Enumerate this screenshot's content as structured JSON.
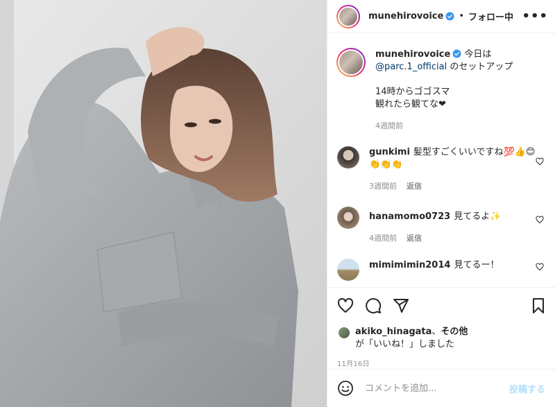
{
  "header": {
    "username": "munehirovoice",
    "separator": "•",
    "follow_status": "フォロー中",
    "more": "•••"
  },
  "caption": {
    "username": "munehirovoice",
    "line1": "今日は",
    "mention": "@parc.1_official",
    "line2": " のセットアップ",
    "line3": "14時からゴゴスマ\n観れたら観てな❤",
    "time": "4週間前"
  },
  "comments": [
    {
      "username": "gunkimi",
      "text": "髪型すごくいいですね💯👍😊👏👏👏",
      "time": "3週間前",
      "reply": "返信"
    },
    {
      "username": "hanamomo0723",
      "text": "見てるよ✨",
      "time": "4週間前",
      "reply": "返信"
    },
    {
      "username": "mimimimin2014",
      "text": "見てるー！"
    }
  ],
  "likes": {
    "user": "akiko_hinagata",
    "joiner": "、",
    "others": "その他",
    "suffix": "が「いいね！」しました"
  },
  "date": "11月16日",
  "add_comment": {
    "placeholder": "コメントを追加...",
    "post_label": "投稿する"
  },
  "icons": {
    "verified": "verified-badge-icon",
    "like": "heart-icon",
    "comment": "speech-bubble-icon",
    "share": "paper-plane-icon",
    "save": "bookmark-icon",
    "emoji": "smiley-icon"
  },
  "colors": {
    "verified": "#3897f0",
    "link": "#00376b",
    "muted": "#8e8e8e",
    "post_button_disabled": "#b2dffc"
  }
}
